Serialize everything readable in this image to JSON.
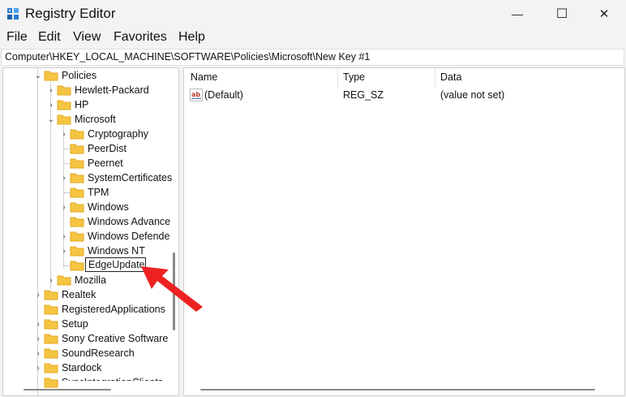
{
  "window": {
    "title": "Registry Editor",
    "minimize_glyph": "—",
    "maximize_glyph": "☐",
    "close_glyph": "✕"
  },
  "menu": [
    "File",
    "Edit",
    "View",
    "Favorites",
    "Help"
  ],
  "address": "Computer\\HKEY_LOCAL_MACHINE\\SOFTWARE\\Policies\\Microsoft\\New Key #1",
  "tree": {
    "policies": "Policies",
    "hewlett_packard": "Hewlett-Packard",
    "hp": "HP",
    "microsoft": "Microsoft",
    "cryptography": "Cryptography",
    "peerdist": "PeerDist",
    "peernet": "Peernet",
    "systemcertificates": "SystemCertificates",
    "tpm": "TPM",
    "windows": "Windows",
    "windows_advanced": "Windows Advance",
    "windows_defender": "Windows Defende",
    "windows_nt": "Windows NT",
    "rename_value": "EdgeUpdate",
    "mozilla": "Mozilla",
    "realtek": "Realtek",
    "registered_applications": "RegisteredApplications",
    "setup": "Setup",
    "sony": "Sony Creative Software",
    "soundresearch": "SoundResearch",
    "stardock": "Stardock",
    "last_partial": "SyncIntegrationClients"
  },
  "list": {
    "headers": {
      "name": "Name",
      "type": "Type",
      "data": "Data"
    },
    "rows": [
      {
        "name": "(Default)",
        "type": "REG_SZ",
        "data": "(value not set)"
      }
    ]
  },
  "colors": {
    "folder": "#f5c542",
    "folder_dark": "#e3a91f",
    "arrow": "#ee2222",
    "accent": "#0067c0"
  }
}
